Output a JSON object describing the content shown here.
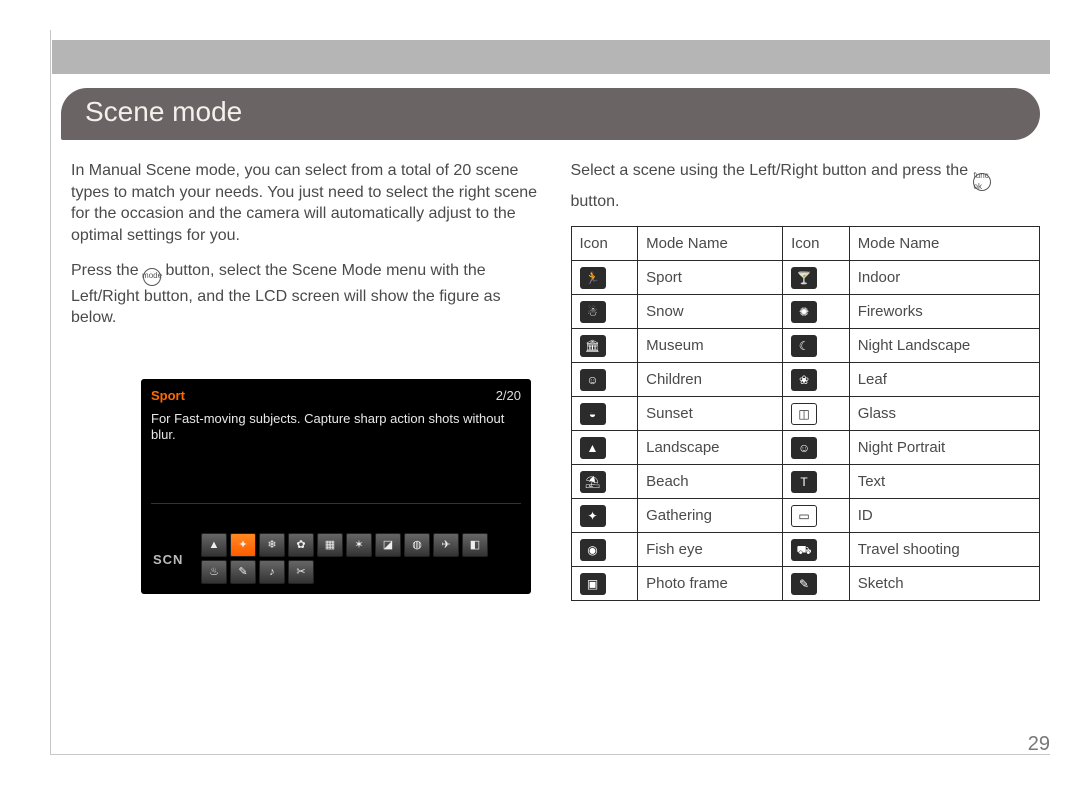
{
  "page": {
    "title": "Scene mode",
    "number": "29"
  },
  "left": {
    "p1": "In Manual Scene mode, you can select from a total of 20 scene types to match your needs. You just need to select the right scene for the occasion and the camera will automatically adjust to the optimal settings for you.",
    "p2a": "Press the ",
    "p2btn": "mode",
    "p2b": " button, select the Scene Mode menu with the Left/Right button, and the LCD screen will show the figure as below."
  },
  "lcd": {
    "selected": "Sport",
    "counter": "2/20",
    "description": "For Fast-moving subjects. Capture sharp action shots without blur.",
    "scn_label": "SCN",
    "tiles": [
      "▲",
      "✦",
      "❄",
      "✿",
      "▦",
      "✶",
      "◪",
      "◍",
      "✈",
      "◧",
      "♨",
      "✎",
      "♪",
      "✂"
    ]
  },
  "right": {
    "intro_a": "Select a scene using the Left/Right button and press the ",
    "intro_btn": "func ok",
    "intro_b": " button.",
    "headers": {
      "icon": "Icon",
      "mode": "Mode Name"
    },
    "rows": [
      {
        "g1": "🏃",
        "n1": "Sport",
        "g2": "🍸",
        "n2": "Indoor"
      },
      {
        "g1": "☃",
        "n1": "Snow",
        "g2": "✺",
        "n2": "Fireworks"
      },
      {
        "g1": "🏛",
        "n1": "Museum",
        "g2": "☾",
        "n2": "Night Landscape"
      },
      {
        "g1": "☺",
        "n1": "Children",
        "g2": "❀",
        "n2": "Leaf"
      },
      {
        "g1": "◒",
        "n1": "Sunset",
        "g2": "◫",
        "n2": "Glass",
        "outline2": true
      },
      {
        "g1": "▲",
        "n1": "Landscape",
        "g2": "☺",
        "n2": "Night Portrait"
      },
      {
        "g1": "⛱",
        "n1": "Beach",
        "g2": "T",
        "n2": "Text"
      },
      {
        "g1": "✦",
        "n1": "Gathering",
        "g2": "▭",
        "n2": "ID",
        "outline2": true
      },
      {
        "g1": "◉",
        "n1": "Fish eye",
        "g2": "⛟",
        "n2": "Travel shooting"
      },
      {
        "g1": "▣",
        "n1": "Photo frame",
        "g2": "✎",
        "n2": "Sketch"
      }
    ]
  }
}
